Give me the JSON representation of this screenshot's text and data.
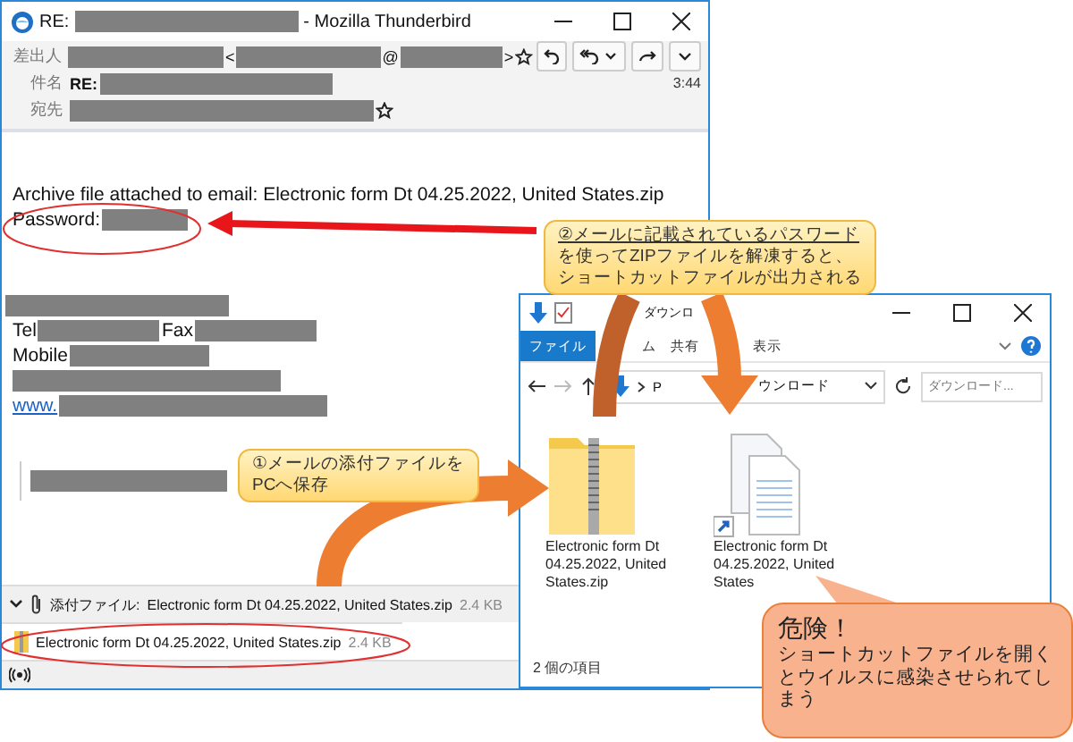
{
  "mail_window": {
    "title": [
      {
        "kind": "text",
        "text": "RE:"
      },
      {
        "kind": "redacted"
      },
      {
        "kind": "text",
        "text": "- Mozilla Thunderbird"
      }
    ],
    "header": {
      "fields": [
        {
          "label": "差出人",
          "star": true,
          "segments": [
            {
              "kind": "redacted"
            },
            {
              "kind": "text",
              "text": "<"
            },
            {
              "kind": "redacted"
            },
            {
              "kind": "text",
              "text": "@"
            },
            {
              "kind": "redacted"
            },
            {
              "kind": "text",
              "text": ">"
            }
          ]
        },
        {
          "label": "件名",
          "star": false,
          "segments": [
            {
              "kind": "bold",
              "text": "RE:"
            },
            {
              "kind": "redacted"
            }
          ]
        },
        {
          "label": "宛先",
          "star": true,
          "segments": [
            {
              "kind": "redacted"
            }
          ]
        }
      ],
      "time": "3:44"
    },
    "body": {
      "message": [
        [
          {
            "kind": "text",
            "text": "Archive file attached to email: Electronic form Dt 04.25.2022, United States.zip"
          }
        ],
        [
          {
            "kind": "text",
            "text": "Password:"
          },
          {
            "kind": "redacted"
          }
        ]
      ],
      "signature": [
        [
          {
            "kind": "redacted"
          }
        ],
        [
          {
            "kind": "text",
            "text": "Tel"
          },
          {
            "kind": "redacted"
          },
          {
            "kind": "text",
            "text": "Fax"
          },
          {
            "kind": "redacted"
          }
        ],
        [
          {
            "kind": "text",
            "text": "Mobile"
          },
          {
            "kind": "redacted"
          }
        ],
        [
          {
            "kind": "redacted"
          }
        ],
        [
          {
            "kind": "link",
            "text": "www."
          },
          {
            "kind": "redacted"
          }
        ]
      ],
      "quote": [
        [
          {
            "kind": "redacted"
          }
        ]
      ]
    },
    "attachment_bar": {
      "label": "添付ファイル:",
      "name": "Electronic form Dt 04.25.2022, United States.zip",
      "size": "2.4 KB"
    },
    "attachments": [
      {
        "name": "Electronic form Dt 04.25.2022, United States.zip",
        "size": "2.4 KB"
      }
    ]
  },
  "explorer_window": {
    "title": "ダウンロ",
    "ribbon_tabs": [
      {
        "label": "ファイル",
        "selected": true
      },
      {
        "label": "ム",
        "selected": false
      },
      {
        "label": "共有",
        "selected": false
      },
      {
        "label": "表示",
        "selected": false
      }
    ],
    "address": {
      "root": "P",
      "folder": "ウンロード"
    },
    "search": {
      "placeholder": "ダウンロード..."
    },
    "files": [
      {
        "kind": "zip",
        "name": "Electronic form Dt 04.25.2022, United States.zip"
      },
      {
        "kind": "shortcut",
        "name": "Electronic form Dt 04.25.2022, United States"
      }
    ],
    "status": "2 個の項目"
  },
  "annotations": [
    {
      "kind": "step",
      "lines": [
        {
          "text": "①メールの添付ファイルを",
          "underlined": false
        },
        {
          "text": "PCへ保存",
          "underlined": false
        }
      ]
    },
    {
      "kind": "step",
      "lines": [
        {
          "text": "②メールに記載されているパスワード",
          "underlined": true
        },
        {
          "text": "を使ってZIPファイルを解凍すると、",
          "underlined": false
        },
        {
          "text": "ショートカットファイルが出力される",
          "underlined": false
        }
      ]
    },
    {
      "kind": "danger",
      "title": "危険！",
      "text": "ショートカットファイルを開くとウイルスに感染させられてしまう"
    }
  ]
}
